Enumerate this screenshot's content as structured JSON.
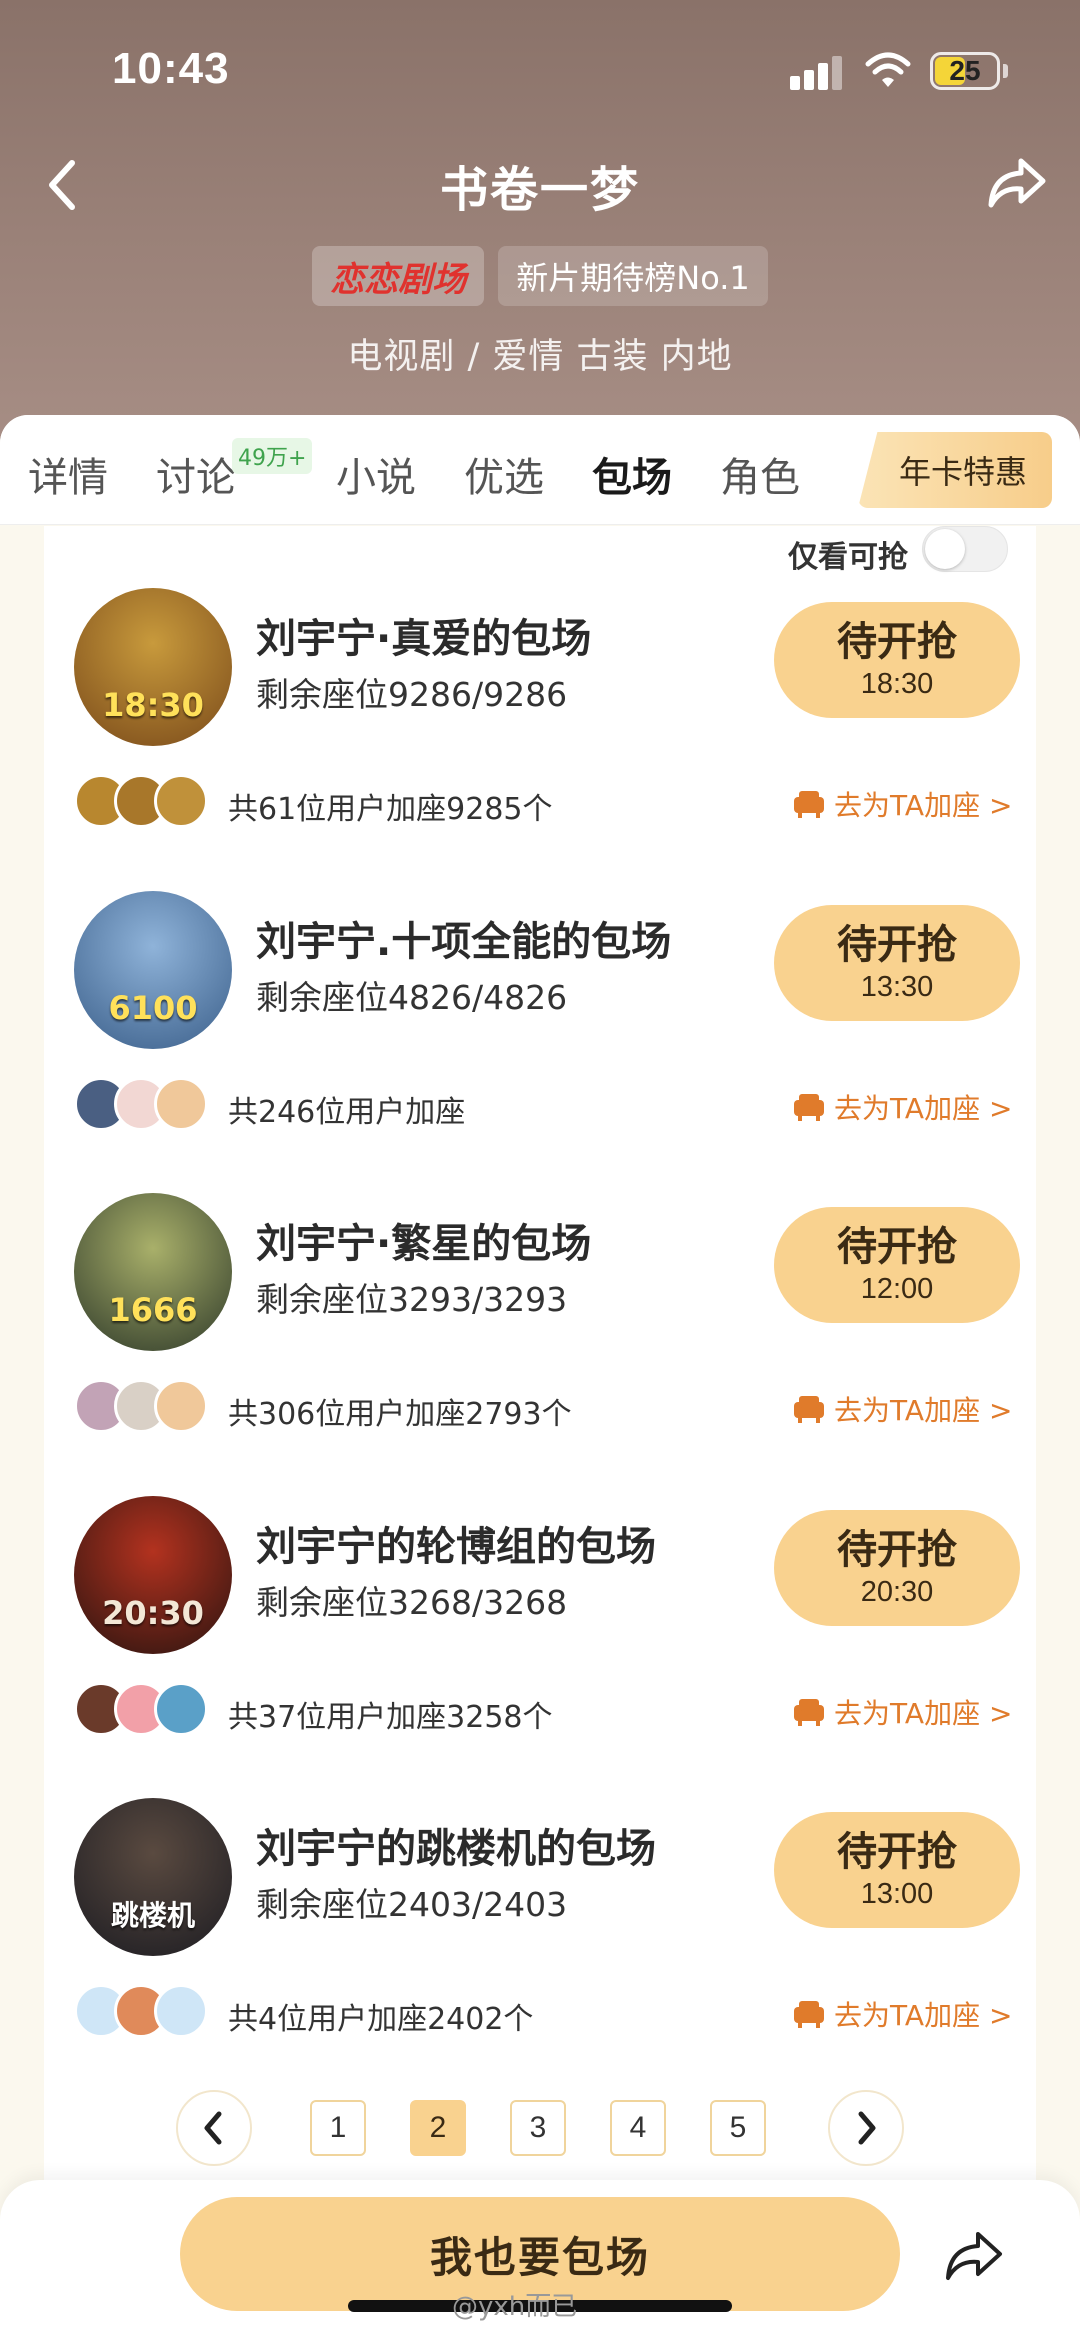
{
  "status_bar": {
    "time": "10:43",
    "battery": "25"
  },
  "header": {
    "title": "书卷一梦",
    "platform_badge": "恋恋剧场",
    "rank_badge": "新片期待榜No.1",
    "genre": "电视剧 / 爱情 古装 内地"
  },
  "tabs": [
    {
      "label": "详情"
    },
    {
      "label": "讨论",
      "badge": "49万+"
    },
    {
      "label": "小说"
    },
    {
      "label": "优选"
    },
    {
      "label": "包场"
    },
    {
      "label": "角色"
    }
  ],
  "annual_card": "年卡特惠",
  "filter": {
    "only_available": "仅看可抢"
  },
  "items": [
    {
      "title": "刘宇宁·真爱的包场",
      "seats": "剩余座位9286/9286",
      "button": "待开抢",
      "time": "18:30",
      "poster_text": "18:30",
      "users": "共61位用户加座9285个",
      "add_link": "去为TA加座 >",
      "colors": [
        "#7a4a1a",
        "#c89a3c"
      ]
    },
    {
      "title": "刘宇宁.十项全能的包场",
      "seats": "剩余座位4826/4826",
      "button": "待开抢",
      "time": "13:30",
      "poster_text": "6100",
      "users": "共246位用户加座",
      "add_link": "去为TA加座 >",
      "colors": [
        "#3b5f8a",
        "#8fb3d9"
      ]
    },
    {
      "title": "刘宇宁·繁星的包场",
      "seats": "剩余座位3293/3293",
      "button": "待开抢",
      "time": "12:00",
      "poster_text": "1666",
      "users": "共306位用户加座2793个",
      "add_link": "去为TA加座 >",
      "colors": [
        "#2f3a2a",
        "#a9b06a"
      ]
    },
    {
      "title": "刘宇宁的轮博组的包场",
      "seats": "剩余座位3268/3268",
      "button": "待开抢",
      "time": "20:30",
      "poster_text": "20:30",
      "users": "共37位用户加座3258个",
      "add_link": "去为TA加座 >",
      "colors": [
        "#2a1410",
        "#b3321f"
      ]
    },
    {
      "title": "刘宇宁的跳楼机的包场",
      "seats": "剩余座位2403/2403",
      "button": "待开抢",
      "time": "13:00",
      "poster_text": "跳楼机",
      "users": "共4位用户加座2402个",
      "add_link": "去为TA加座 >",
      "colors": [
        "#1c1c22",
        "#5a4a40"
      ]
    }
  ],
  "pagination": {
    "pages": [
      "1",
      "2",
      "3",
      "4",
      "5"
    ],
    "current": "2"
  },
  "cta": "我也要包场",
  "watermark": "@yxh而已"
}
